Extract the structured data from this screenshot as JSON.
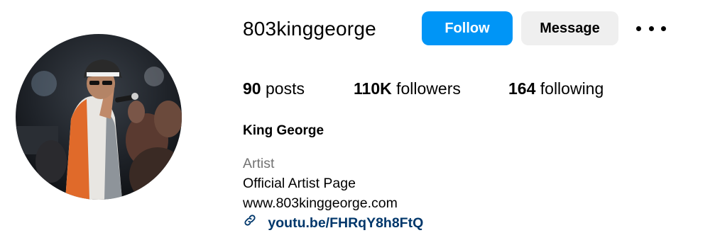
{
  "profile": {
    "username": "803kinggeorge",
    "avatar_icon": "profile-photo",
    "follow_label": "Follow",
    "message_label": "Message",
    "more_icon": "more-options-icon",
    "stats": {
      "posts_count": "90",
      "posts_label": "posts",
      "followers_count": "110K",
      "followers_label": "followers",
      "following_count": "164",
      "following_label": "following"
    },
    "full_name": "King George",
    "category": "Artist",
    "bio_line": "Official Artist Page",
    "website": "www.803kinggeorge.com",
    "link_icon": "link-icon",
    "link": "youtu.be/FHRqY8h8FtQ"
  },
  "colors": {
    "follow_button": "#0095f6",
    "message_button": "#efefef",
    "category_text": "#737373",
    "link_text": "#00376b"
  }
}
